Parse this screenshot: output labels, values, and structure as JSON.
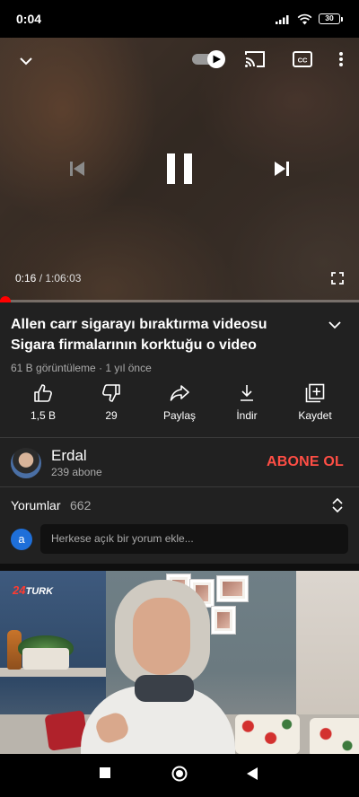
{
  "status_bar": {
    "time": "0:04",
    "battery": "30"
  },
  "player": {
    "current_time": "0:16",
    "separator": " / ",
    "duration": "1:06:03",
    "progress": 0.004,
    "autoplay_on": true
  },
  "video": {
    "title": "Allen carr sigarayı bıraktırma videosu Sigara firmalarının korktuğu o video",
    "views": "61 B görüntüleme",
    "meta_sep": " · ",
    "age": "1 yıl önce"
  },
  "actions": [
    {
      "icon": "thumbs-up-icon",
      "label": "1,5 B"
    },
    {
      "icon": "thumbs-down-icon",
      "label": "29"
    },
    {
      "icon": "share-icon",
      "label": "Paylaş"
    },
    {
      "icon": "download-icon",
      "label": "İndir"
    },
    {
      "icon": "save-playlist-icon",
      "label": "Kaydet"
    }
  ],
  "channel": {
    "name": "Erdal",
    "subscribers": "239 abone",
    "subscribe_label": "ABONE OL"
  },
  "comments": {
    "label": "Yorumlar",
    "count": "662",
    "user_initial": "a",
    "placeholder": "Herkese açık bir yorum ekle..."
  },
  "thumbnail": {
    "logo_text": "TURK",
    "logo_num": "24"
  },
  "colors": {
    "accent_red": "#ff0000",
    "subscribe_red": "#ff4e45",
    "surface": "#212121"
  }
}
